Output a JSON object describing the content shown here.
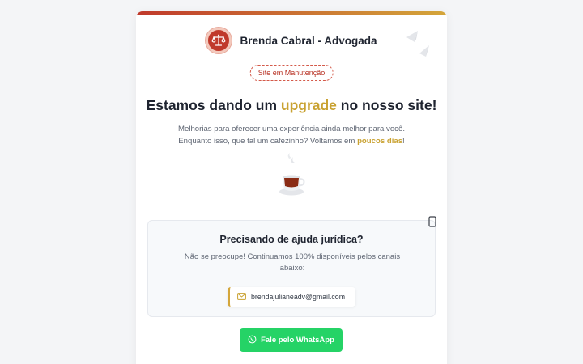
{
  "brand": {
    "name": "Brenda Cabral - Advogada",
    "logo_icon": "scales-of-justice-icon"
  },
  "badge": {
    "label": "Site em Manutenção"
  },
  "headline": {
    "before": "Estamos dando um ",
    "highlight": "upgrade",
    "after": " no nosso site!"
  },
  "subtitle": {
    "line1": "Melhorias para oferecer uma experiência ainda melhor para você.",
    "line2_before": "Enquanto isso, que tal um cafezinho? Voltamos em ",
    "line2_highlight": "poucos dias",
    "line2_after": "!"
  },
  "illustration": {
    "icon": "coffee-cup-icon"
  },
  "help": {
    "title": "Precisando de ajuda jurídica?",
    "text": "Não se preocupe! Continuamos 100% disponíveis pelos canais abaixo:",
    "email": "brendajulianeadv@gmail.com",
    "email_icon": "envelope-icon"
  },
  "whatsapp_button": {
    "label": "Fale pelo WhatsApp",
    "icon": "whatsapp-icon"
  },
  "colors": {
    "accent_red": "#c0392b",
    "accent_gold": "#c9a232",
    "whatsapp_green": "#25d366",
    "text_dark": "#1f2430",
    "text_muted": "#5f6673"
  }
}
